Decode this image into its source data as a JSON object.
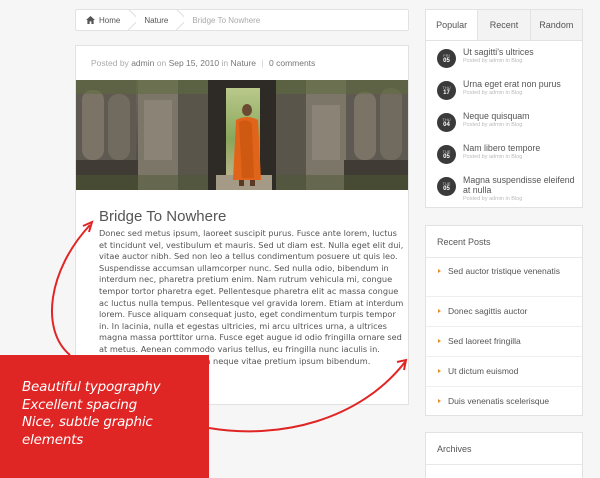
{
  "breadcrumb": {
    "home": "Home",
    "category": "Nature",
    "current": "Bridge To Nowhere"
  },
  "post": {
    "meta": {
      "posted_by": "Posted by",
      "author": "admin",
      "on": "on",
      "date": "Sep 15, 2010",
      "in": "in",
      "category": "Nature",
      "comments": "0 comments"
    },
    "title": "Bridge To Nowhere",
    "body": "Donec sed metus ipsum, laoreet suscipit purus. Fusce ante lorem, luctus et tincidunt vel, vestibulum et mauris. Sed ut diam est. Nulla eget elit dui, vitae auctor nibh. Sed non leo a tellus condimentum posuere ut quis leo. Suspendisse accumsan ullamcorper nunc. Sed nulla odio, bibendum in interdum nec, pharetra pretium enim. Nam rutrum vehicula mi, congue tempor tortor pharetra eget. Pellentesque pharetra elit ac massa congue ac luctus nulla tempus. Pellentesque vel gravida lorem. Etiam at interdum lorem. Fusce aliquam consequat justo, eget condimentum turpis tempor in. In lacinia, nulla et egestas ultricies, mi arcu ultrices urna, a ultrices magna massa porttitor urna. Fusce eget augue id odio fringilla ornare sed at metus. Aenean commodo varius tellus, eu fringilla nunc iaculis in. Aenean molestie ligula non neque vitae pretium ipsum bibendum."
  },
  "tabs_widget": {
    "tabs": [
      "Popular",
      "Recent",
      "Random"
    ],
    "active": "Popular",
    "posts": [
      {
        "day": "FRI",
        "num": "05",
        "title": "Ut sagitti's ultrices",
        "sub": "Posted by admin in Blog"
      },
      {
        "day": "THU",
        "num": "17",
        "title": "Urna eget erat non purus",
        "sub": "Posted by admin in Blog"
      },
      {
        "day": "THU",
        "num": "04",
        "title": "Neque quisquam",
        "sub": "Posted by admin in Blog"
      },
      {
        "day": "TUE",
        "num": "05",
        "title": "Nam libero tempore",
        "sub": "Posted by admin in Blog"
      },
      {
        "day": "TUE",
        "num": "05",
        "title": "Magna suspendisse eleifend at nulla",
        "sub": "Posted by admin in Blog"
      }
    ]
  },
  "recent_widget": {
    "title": "Recent Posts",
    "items": [
      "Sed auctor tristique venenatis",
      "Donec sagittis auctor",
      "Sed laoreet fringilla",
      "Ut dictum euismod",
      "Duis venenatis scelerisque"
    ]
  },
  "archives_widget": {
    "title": "Archives"
  },
  "promo": {
    "lines": [
      "Beautiful typography",
      "Excellent spacing",
      "Nice, subtle graphic",
      "elements"
    ]
  },
  "colors": {
    "accent_red": "#e02525",
    "bullet_orange": "#e0922a",
    "badge_dark": "#3a3a3a"
  }
}
